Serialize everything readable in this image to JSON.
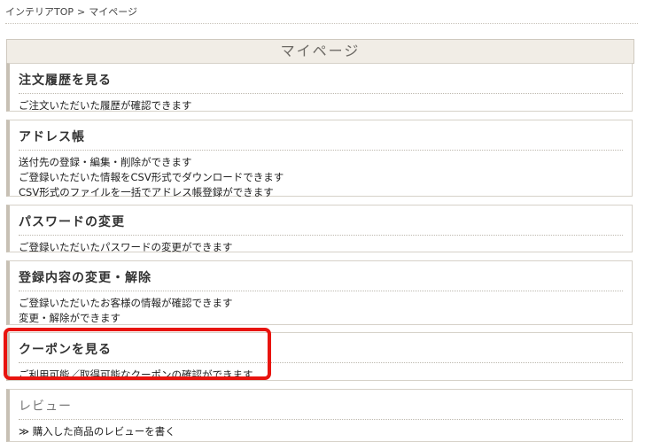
{
  "breadcrumb": {
    "home": "インテリアTOP",
    "separator": ">",
    "current": "マイページ"
  },
  "page_title": "マイページ",
  "sections": {
    "orders": {
      "title": "注文履歴を見る",
      "lines": [
        "ご注文いただいた履歴が確認できます"
      ]
    },
    "address": {
      "title": "アドレス帳",
      "lines": [
        "送付先の登録・編集・削除ができます",
        "ご登録いただいた情報をCSV形式でダウンロードできます",
        "CSV形式のファイルを一括でアドレス帳登録ができます"
      ]
    },
    "password": {
      "title": "パスワードの変更",
      "lines": [
        "ご登録いただいたパスワードの変更ができます"
      ]
    },
    "profile": {
      "title": "登録内容の変更・解除",
      "lines": [
        "ご登録いただいたお客様の情報が確認できます",
        "変更・解除ができます"
      ]
    },
    "coupon": {
      "title": "クーポンを見る",
      "lines": [
        "ご利用可能／取得可能なクーポンの確認ができます"
      ]
    },
    "review": {
      "title": "レビュー",
      "lines": [
        "≫ 購入した商品のレビューを書く"
      ]
    }
  },
  "highlight_color": "#e8140f"
}
